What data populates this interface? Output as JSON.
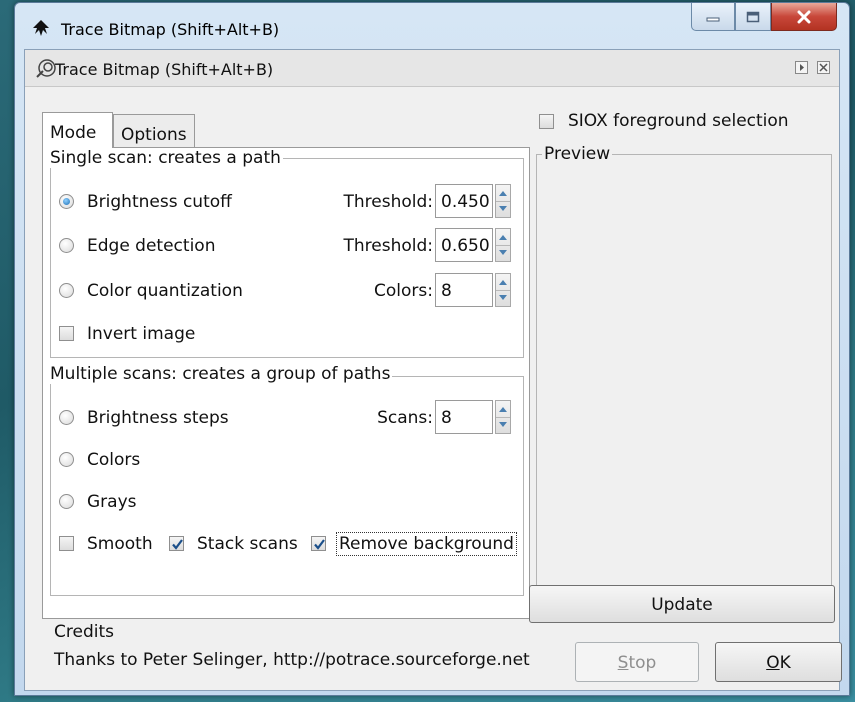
{
  "window": {
    "title": "Trace Bitmap (Shift+Alt+B)",
    "controls": {
      "minimize": "minimize-icon",
      "maximize": "maximize-icon",
      "close": "close-icon"
    }
  },
  "dock": {
    "title": "Trace Bitmap (Shift+Alt+B)",
    "icon": "trace-bitmap-icon",
    "buttons": [
      "dock-expand-icon",
      "dock-close-icon"
    ]
  },
  "tabs": [
    {
      "label": "Mode",
      "active": true
    },
    {
      "label": "Options",
      "active": false
    }
  ],
  "single_scan": {
    "legend": "Single scan: creates a path",
    "options": [
      {
        "label": "Brightness cutoff",
        "selected": true,
        "param_label": "Threshold:",
        "param_value": "0.450"
      },
      {
        "label": "Edge detection",
        "selected": false,
        "param_label": "Threshold:",
        "param_value": "0.650"
      },
      {
        "label": "Color quantization",
        "selected": false,
        "param_label": "Colors:",
        "param_value": "8"
      }
    ],
    "invert": {
      "label": "Invert image",
      "checked": false
    }
  },
  "multiple_scans": {
    "legend": "Multiple scans: creates a group of paths",
    "options": [
      {
        "label": "Brightness steps",
        "selected": false,
        "param_label": "Scans:",
        "param_value": "8"
      },
      {
        "label": "Colors",
        "selected": false
      },
      {
        "label": "Grays",
        "selected": false
      }
    ],
    "checks": [
      {
        "label": "Smooth",
        "checked": false
      },
      {
        "label": "Stack scans",
        "checked": true
      },
      {
        "label": "Remove background",
        "checked": true
      }
    ]
  },
  "credits": {
    "title": "Credits",
    "text": "Thanks to Peter Selinger, http://potrace.sourceforge.net"
  },
  "siox": {
    "label": "SIOX foreground selection",
    "checked": false
  },
  "preview": {
    "legend": "Preview"
  },
  "buttons": {
    "update": "Update",
    "stop_mnemonic": "S",
    "stop_rest": "top",
    "ok_mnemonic": "O",
    "ok_rest": "K"
  },
  "colors": {
    "radio_selected": "#1d6fb5",
    "close_button": "#c8473a",
    "desktop": "#2b6a78"
  }
}
